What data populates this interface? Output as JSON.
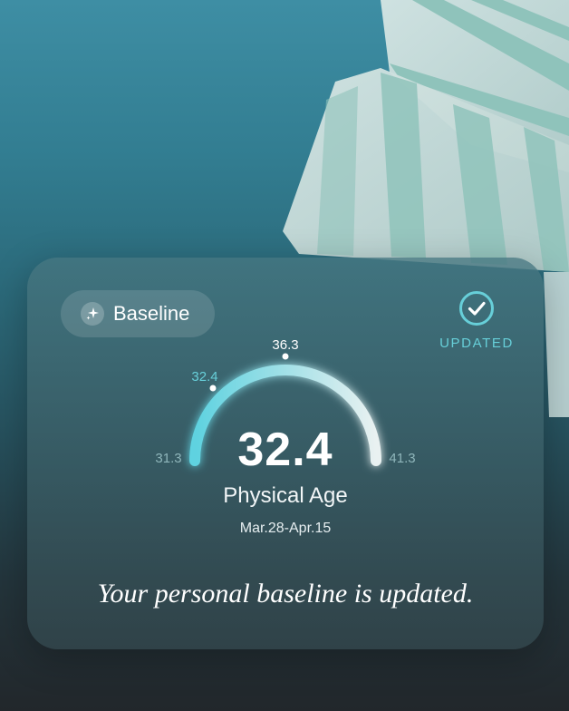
{
  "baseline": {
    "label": "Baseline",
    "icon": "sparkle-icon"
  },
  "status": {
    "label": "UPDATED",
    "icon": "check-circle-icon",
    "color": "#67cfd9"
  },
  "gauge": {
    "min_label": "31.3",
    "max_label": "41.3",
    "mid_label": "36.3",
    "marker_label": "32.4",
    "value": 32.4,
    "min": 31.3,
    "max": 41.3,
    "value_text": "32.4",
    "accent": "#5ed2e0"
  },
  "metric": {
    "title": "Physical Age",
    "date_range": "Mar.28-Apr.15"
  },
  "message": "Your personal baseline is updated."
}
